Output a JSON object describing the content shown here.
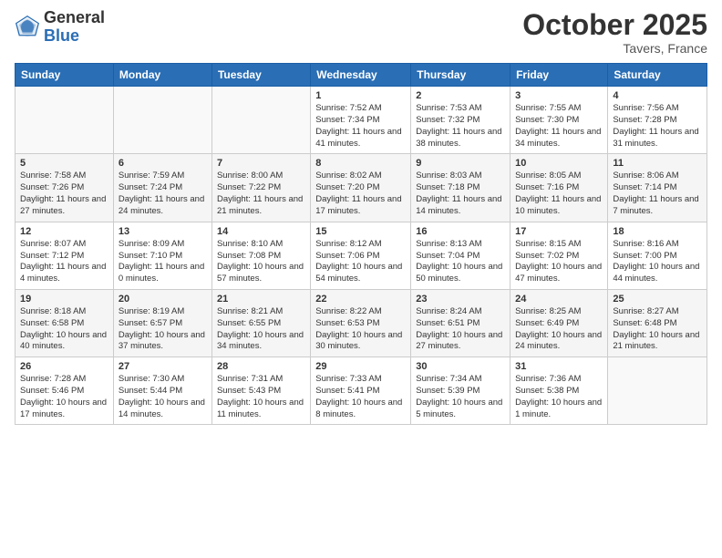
{
  "header": {
    "logo_general": "General",
    "logo_blue": "Blue",
    "month": "October 2025",
    "location": "Tavers, France"
  },
  "weekdays": [
    "Sunday",
    "Monday",
    "Tuesday",
    "Wednesday",
    "Thursday",
    "Friday",
    "Saturday"
  ],
  "weeks": [
    [
      {
        "day": "",
        "info": ""
      },
      {
        "day": "",
        "info": ""
      },
      {
        "day": "",
        "info": ""
      },
      {
        "day": "1",
        "info": "Sunrise: 7:52 AM\nSunset: 7:34 PM\nDaylight: 11 hours\nand 41 minutes."
      },
      {
        "day": "2",
        "info": "Sunrise: 7:53 AM\nSunset: 7:32 PM\nDaylight: 11 hours\nand 38 minutes."
      },
      {
        "day": "3",
        "info": "Sunrise: 7:55 AM\nSunset: 7:30 PM\nDaylight: 11 hours\nand 34 minutes."
      },
      {
        "day": "4",
        "info": "Sunrise: 7:56 AM\nSunset: 7:28 PM\nDaylight: 11 hours\nand 31 minutes."
      }
    ],
    [
      {
        "day": "5",
        "info": "Sunrise: 7:58 AM\nSunset: 7:26 PM\nDaylight: 11 hours\nand 27 minutes."
      },
      {
        "day": "6",
        "info": "Sunrise: 7:59 AM\nSunset: 7:24 PM\nDaylight: 11 hours\nand 24 minutes."
      },
      {
        "day": "7",
        "info": "Sunrise: 8:00 AM\nSunset: 7:22 PM\nDaylight: 11 hours\nand 21 minutes."
      },
      {
        "day": "8",
        "info": "Sunrise: 8:02 AM\nSunset: 7:20 PM\nDaylight: 11 hours\nand 17 minutes."
      },
      {
        "day": "9",
        "info": "Sunrise: 8:03 AM\nSunset: 7:18 PM\nDaylight: 11 hours\nand 14 minutes."
      },
      {
        "day": "10",
        "info": "Sunrise: 8:05 AM\nSunset: 7:16 PM\nDaylight: 11 hours\nand 10 minutes."
      },
      {
        "day": "11",
        "info": "Sunrise: 8:06 AM\nSunset: 7:14 PM\nDaylight: 11 hours\nand 7 minutes."
      }
    ],
    [
      {
        "day": "12",
        "info": "Sunrise: 8:07 AM\nSunset: 7:12 PM\nDaylight: 11 hours\nand 4 minutes."
      },
      {
        "day": "13",
        "info": "Sunrise: 8:09 AM\nSunset: 7:10 PM\nDaylight: 11 hours\nand 0 minutes."
      },
      {
        "day": "14",
        "info": "Sunrise: 8:10 AM\nSunset: 7:08 PM\nDaylight: 10 hours\nand 57 minutes."
      },
      {
        "day": "15",
        "info": "Sunrise: 8:12 AM\nSunset: 7:06 PM\nDaylight: 10 hours\nand 54 minutes."
      },
      {
        "day": "16",
        "info": "Sunrise: 8:13 AM\nSunset: 7:04 PM\nDaylight: 10 hours\nand 50 minutes."
      },
      {
        "day": "17",
        "info": "Sunrise: 8:15 AM\nSunset: 7:02 PM\nDaylight: 10 hours\nand 47 minutes."
      },
      {
        "day": "18",
        "info": "Sunrise: 8:16 AM\nSunset: 7:00 PM\nDaylight: 10 hours\nand 44 minutes."
      }
    ],
    [
      {
        "day": "19",
        "info": "Sunrise: 8:18 AM\nSunset: 6:58 PM\nDaylight: 10 hours\nand 40 minutes."
      },
      {
        "day": "20",
        "info": "Sunrise: 8:19 AM\nSunset: 6:57 PM\nDaylight: 10 hours\nand 37 minutes."
      },
      {
        "day": "21",
        "info": "Sunrise: 8:21 AM\nSunset: 6:55 PM\nDaylight: 10 hours\nand 34 minutes."
      },
      {
        "day": "22",
        "info": "Sunrise: 8:22 AM\nSunset: 6:53 PM\nDaylight: 10 hours\nand 30 minutes."
      },
      {
        "day": "23",
        "info": "Sunrise: 8:24 AM\nSunset: 6:51 PM\nDaylight: 10 hours\nand 27 minutes."
      },
      {
        "day": "24",
        "info": "Sunrise: 8:25 AM\nSunset: 6:49 PM\nDaylight: 10 hours\nand 24 minutes."
      },
      {
        "day": "25",
        "info": "Sunrise: 8:27 AM\nSunset: 6:48 PM\nDaylight: 10 hours\nand 21 minutes."
      }
    ],
    [
      {
        "day": "26",
        "info": "Sunrise: 7:28 AM\nSunset: 5:46 PM\nDaylight: 10 hours\nand 17 minutes."
      },
      {
        "day": "27",
        "info": "Sunrise: 7:30 AM\nSunset: 5:44 PM\nDaylight: 10 hours\nand 14 minutes."
      },
      {
        "day": "28",
        "info": "Sunrise: 7:31 AM\nSunset: 5:43 PM\nDaylight: 10 hours\nand 11 minutes."
      },
      {
        "day": "29",
        "info": "Sunrise: 7:33 AM\nSunset: 5:41 PM\nDaylight: 10 hours\nand 8 minutes."
      },
      {
        "day": "30",
        "info": "Sunrise: 7:34 AM\nSunset: 5:39 PM\nDaylight: 10 hours\nand 5 minutes."
      },
      {
        "day": "31",
        "info": "Sunrise: 7:36 AM\nSunset: 5:38 PM\nDaylight: 10 hours\nand 1 minute."
      },
      {
        "day": "",
        "info": ""
      }
    ]
  ]
}
